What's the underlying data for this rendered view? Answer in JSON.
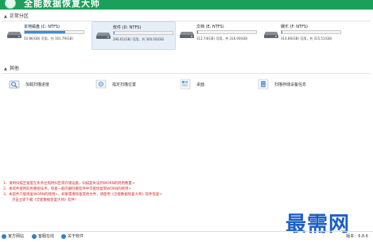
{
  "app": {
    "title": "全能数据恢复大师",
    "brand_color": "#1aa05a"
  },
  "sections": {
    "partitions_header": "正常分区",
    "other_header": "其他"
  },
  "drives": [
    {
      "label": "本地磁盘 (C: NTFS)",
      "stats": "50.86(GB) 可用，共 161.79(GB)",
      "used_fraction": 0.69,
      "selected": false
    },
    {
      "label": "软件 (D: NTFS)",
      "stats": "296.61(GB) 可用，共 300.00(GB)",
      "used_fraction": 0.01,
      "selected": true
    },
    {
      "label": "文档 (E: NTFS)",
      "stats": "312.74(GB) 可用，共 316.00(GB)",
      "used_fraction": 0.01,
      "selected": false
    },
    {
      "label": "娱乐 (F: NTFS)",
      "stats": "314.86(GB) 可用，共 315.51(GB)",
      "used_fraction": 0.01,
      "selected": false
    }
  ],
  "tools": [
    {
      "label": "加载扫描进度",
      "icon": "magnifier-load-icon"
    },
    {
      "label": "指定扫描位置",
      "icon": "target-location-icon"
    },
    {
      "label": "桌面",
      "icon": "desktop-icon"
    },
    {
      "label": "扫描存储设备信息",
      "icon": "storage-scan-icon"
    }
  ],
  "notes": [
    "1、请将扫描至速度在条条左照例扫区或存储设备，扫描是失误到WORN的耗用数量>",
    "2、本软件使用彩色重组技术，恢复一般的删除重软件中可能恢复到WORN的耗用>",
    "3、本软件只能恢复WORN的耗用>，如果需要恢复其他文件，请使用《全能数据恢复大师》软件恢复>",
    "点击立即下载《全能数据恢复大师》软件！"
  ],
  "statusbar": {
    "links": [
      "官方网站",
      "客服在线",
      "关于软件"
    ],
    "version": "版本：6.8.6"
  },
  "watermark": "最需网"
}
